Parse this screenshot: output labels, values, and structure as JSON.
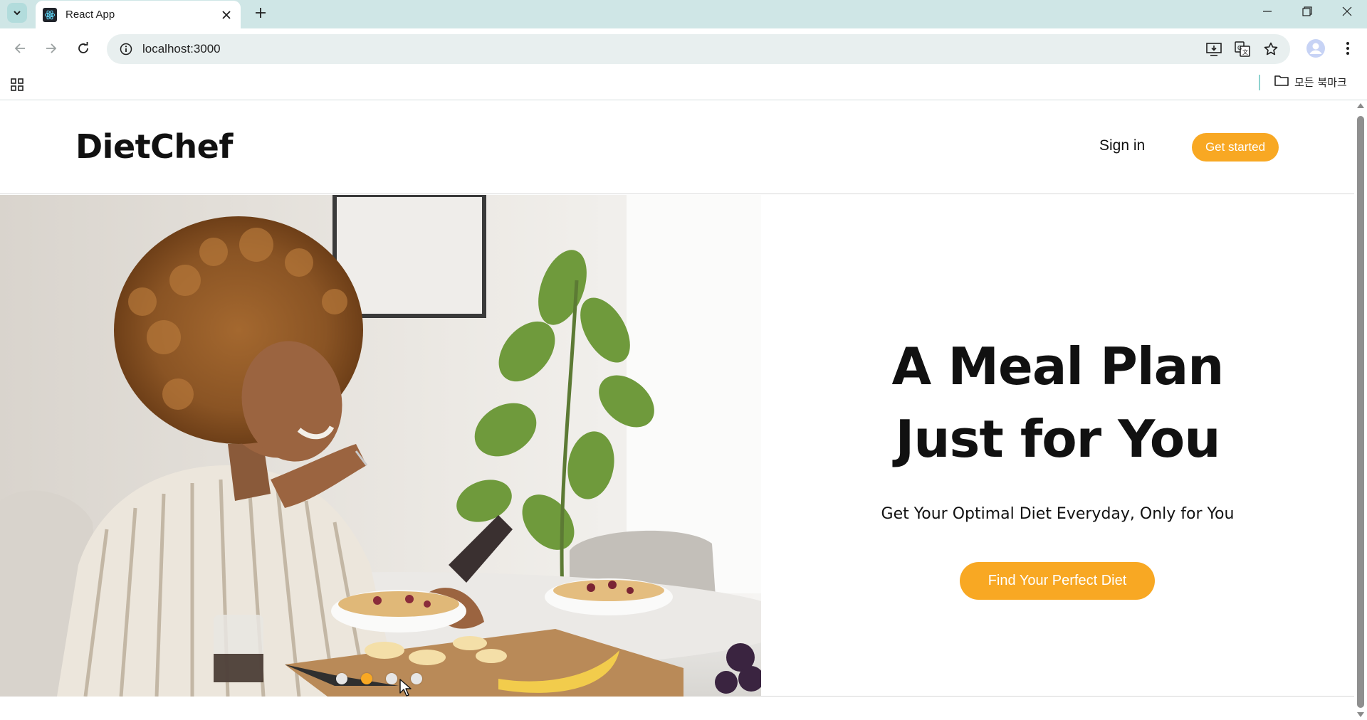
{
  "browser": {
    "tab_title": "React App",
    "url": "localhost:3000",
    "bookmarks_all_label": "모든 북마크",
    "icons": [
      "tab-search-icon",
      "react-favicon-icon",
      "close-icon",
      "plus-icon",
      "minimize-icon",
      "restore-icon",
      "window-close-icon",
      "back-icon",
      "forward-icon",
      "reload-icon",
      "info-icon",
      "install-icon",
      "translate-icon",
      "star-icon",
      "profile-icon",
      "more-vert-icon",
      "apps-icon",
      "folder-icon"
    ]
  },
  "site": {
    "logo": "DietChef",
    "nav": {
      "signin_label": "Sign in",
      "get_started_label": "Get started"
    },
    "hero": {
      "headline_line1": "A Meal Plan",
      "headline_line2": "Just for You",
      "subline": "Get Your Optimal Diet Everyday, Only for You",
      "cta_label": "Find Your Perfect Diet",
      "carousel": {
        "slide_count": 4,
        "active_index": 1
      }
    }
  },
  "colors": {
    "accent": "#f8a823",
    "tabstrip": "#cfe6e6",
    "omnibox": "#e8efef",
    "text": "#111111"
  }
}
